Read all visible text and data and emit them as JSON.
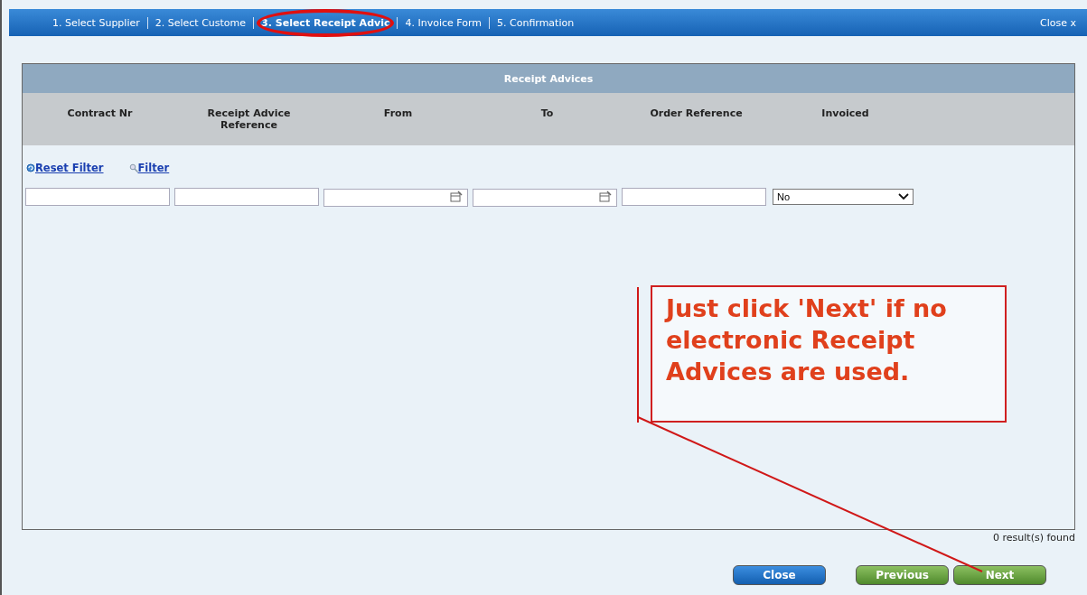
{
  "wizard": {
    "steps": [
      {
        "label": "1. Select Supplier",
        "selected": false
      },
      {
        "label": "2. Select Custome",
        "selected": false
      },
      {
        "label": "3. Select Receipt Advic",
        "selected": true
      },
      {
        "label": "4. Invoice Form",
        "selected": false
      },
      {
        "label": "5. Confirmation",
        "selected": false
      }
    ],
    "close": "Close x"
  },
  "panel": {
    "title": "Receipt Advices",
    "columns": [
      "Contract Nr",
      "Receipt Advice Reference",
      "From",
      "To",
      "Order Reference",
      "Invoiced"
    ],
    "links": [
      {
        "label": "Reset Filter",
        "kind": "reset"
      },
      {
        "label": "Filter",
        "kind": "filter"
      }
    ],
    "filters": [
      {
        "kind": "text"
      },
      {
        "kind": "text"
      },
      {
        "kind": "date"
      },
      {
        "kind": "date"
      },
      {
        "kind": "text"
      },
      {
        "kind": "select",
        "value": "No"
      }
    ]
  },
  "results": "0 result(s) found",
  "buttons": [
    {
      "label": "Close",
      "kind": "close"
    },
    {
      "label": "Previous",
      "kind": "nav"
    },
    {
      "label": "Next",
      "kind": "nav"
    }
  ],
  "callout": {
    "text": "Just click 'Next' if no electronic Receipt Advices are used."
  }
}
